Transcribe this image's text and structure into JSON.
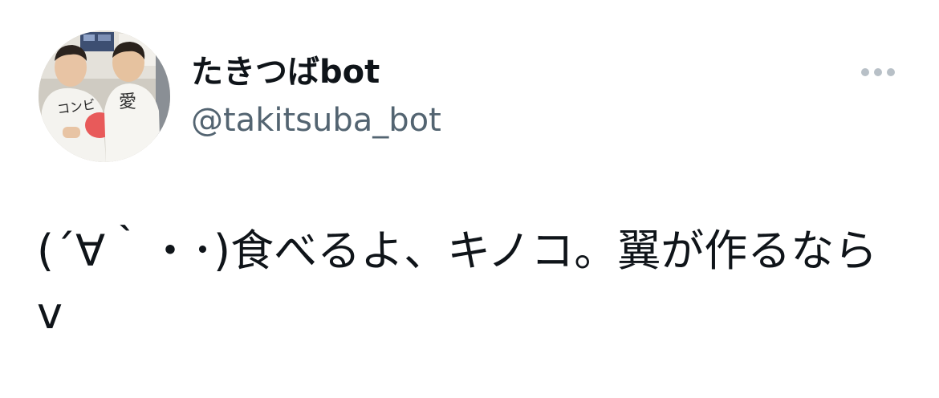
{
  "author": {
    "display_name": "たきつばbot",
    "handle": "@takitsuba_bot",
    "avatar_shirt_text_left": "コンビ",
    "avatar_shirt_text_right": "愛"
  },
  "menu": {
    "icon": "more-horizontal-icon"
  },
  "tweet": {
    "text": "(´∀｀・･)食べるよ、キノコ。翼が作るならv"
  },
  "colors": {
    "primary_text": "#0f1419",
    "secondary_text": "#536471",
    "icon_gray": "#b8c0c7",
    "background": "#ffffff"
  }
}
